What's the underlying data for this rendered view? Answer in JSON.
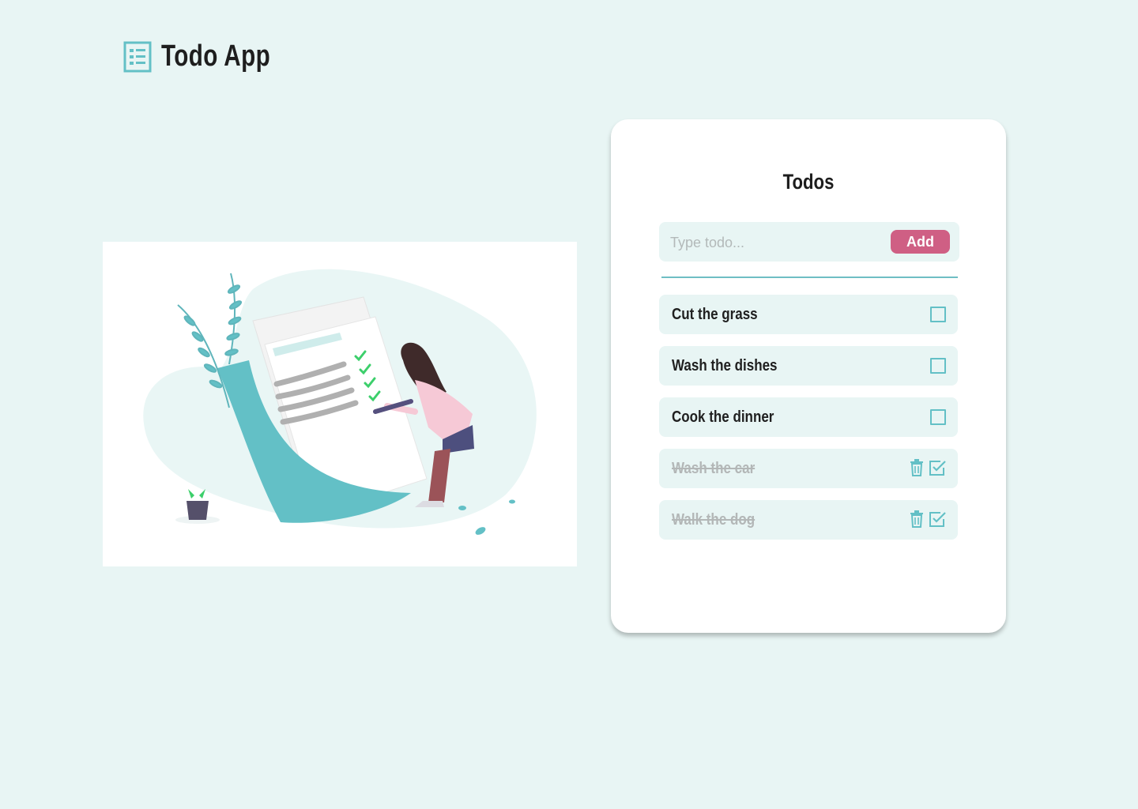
{
  "app": {
    "title": "Todo App",
    "logo_icon": "list-icon",
    "accent_color": "#63c0c6",
    "background_color": "#e8f5f4"
  },
  "illustration": {
    "icon": "todo-checklist-illustration"
  },
  "card": {
    "title": "Todos",
    "input": {
      "value": "",
      "placeholder": "Type todo..."
    },
    "add_button_label": "Add",
    "add_button_color": "#cf5f84"
  },
  "todos": [
    {
      "text": "Cut the grass",
      "completed": false
    },
    {
      "text": "Wash the dishes",
      "completed": false
    },
    {
      "text": "Cook the dinner",
      "completed": false
    },
    {
      "text": "Wash the car",
      "completed": true
    },
    {
      "text": "Walk the dog",
      "completed": true
    }
  ]
}
